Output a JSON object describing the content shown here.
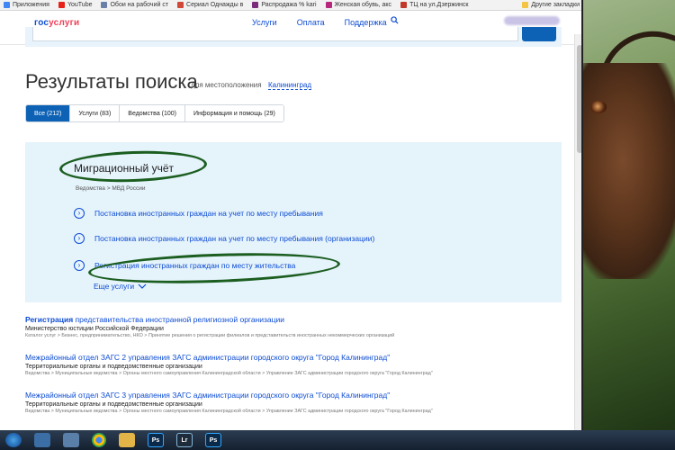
{
  "bookmarks": [
    {
      "label": "Приложения",
      "color": "#4285f4"
    },
    {
      "label": "YouTube",
      "color": "#e62117"
    },
    {
      "label": "Обои на рабочий ст",
      "color": "#6a7fa8"
    },
    {
      "label": "Сериал Однажды в",
      "color": "#d14836"
    },
    {
      "label": "Распродажа % kari",
      "color": "#7b2d7b"
    },
    {
      "label": "Женская обувь, акс",
      "color": "#b5287c"
    },
    {
      "label": "ТЦ на ул.Дзержинск",
      "color": "#c0392b"
    },
    {
      "label": "Другие закладки",
      "color": "#f4c542"
    }
  ],
  "header": {
    "logo_part1": "гос",
    "logo_part2": "услуги",
    "nav": [
      "Услуги",
      "Оплата",
      "Поддержка"
    ]
  },
  "search": {
    "title": "Результаты поиска",
    "location_label": "для местоположения",
    "location_value": "Калининград"
  },
  "tabs": [
    {
      "label": "Все (212)",
      "active": true
    },
    {
      "label": "Услуги (83)",
      "active": false
    },
    {
      "label": "Ведомства (100)",
      "active": false
    },
    {
      "label": "Информация и помощь (29)",
      "active": false
    }
  ],
  "migration": {
    "title": "Миграционный учёт",
    "breadcrumb": "Ведомства > МВД России",
    "services": [
      "Постановка иностранных граждан на учет по месту пребывания",
      "Постановка иностранных граждан на учет по месту пребывания (организации)",
      "Регистрация иностранных граждан по месту жительства"
    ],
    "more_label": "Еще услуги"
  },
  "results": [
    {
      "title_bold": "Регистрация",
      "title_rest": " представительства иностранной религиозной организации",
      "subtitle": "Министерство юстиции Российской Федерации",
      "crumb": "Каталог услуг > Бизнес, предпринимательство, НКО > Принятие решения о регистрации филиалов и представительств иностранных некоммерческих организаций"
    },
    {
      "title_bold": "",
      "title_rest": "Межрайонный отдел ЗАГС 2 управления ЗАГС администрации городского округа \"Город Калининград\"",
      "subtitle": "Территориальные органы и подведомственные организации",
      "crumb": "Ведомства > Муниципальные ведомства > Органы местного самоуправления Калининградской области > Управление ЗАГС администрации городского округа \"Город Калининград\""
    },
    {
      "title_bold": "",
      "title_rest": "Межрайонный отдел ЗАГС 3 управления ЗАГС администрации городского округа \"Город Калининград\"",
      "subtitle": "Территориальные органы и подведомственные организации",
      "crumb": "Ведомства > Муниципальные ведомства > Органы местного самоуправления Калининградской области > Управление ЗАГС администрации городского округа \"Город Калининград\""
    }
  ],
  "taskbar": {
    "items": [
      {
        "icon": "windows-start-icon",
        "text": "",
        "color": "#1d5ea8"
      },
      {
        "icon": "file-explorer-pin-icon",
        "text": "",
        "color": "#3b6ea5"
      },
      {
        "icon": "document-icon",
        "text": "",
        "color": "#5a7fa8"
      },
      {
        "icon": "chrome-icon",
        "text": "",
        "color": "#3aa757"
      },
      {
        "icon": "folder-icon",
        "text": "",
        "color": "#e3b448"
      },
      {
        "icon": "photoshop-icon",
        "text": "Ps",
        "color": "#0b2a4a"
      },
      {
        "icon": "lightroom-icon",
        "text": "Lr",
        "color": "#1d2b3a"
      },
      {
        "icon": "photoshop-icon-2",
        "text": "Ps",
        "color": "#0b2a4a"
      }
    ]
  },
  "colors": {
    "accent": "#0d4cd3",
    "button_blue": "#0d62b5",
    "highlight_box": "#e5f3fb",
    "annotation_green": "#1b5e20"
  }
}
